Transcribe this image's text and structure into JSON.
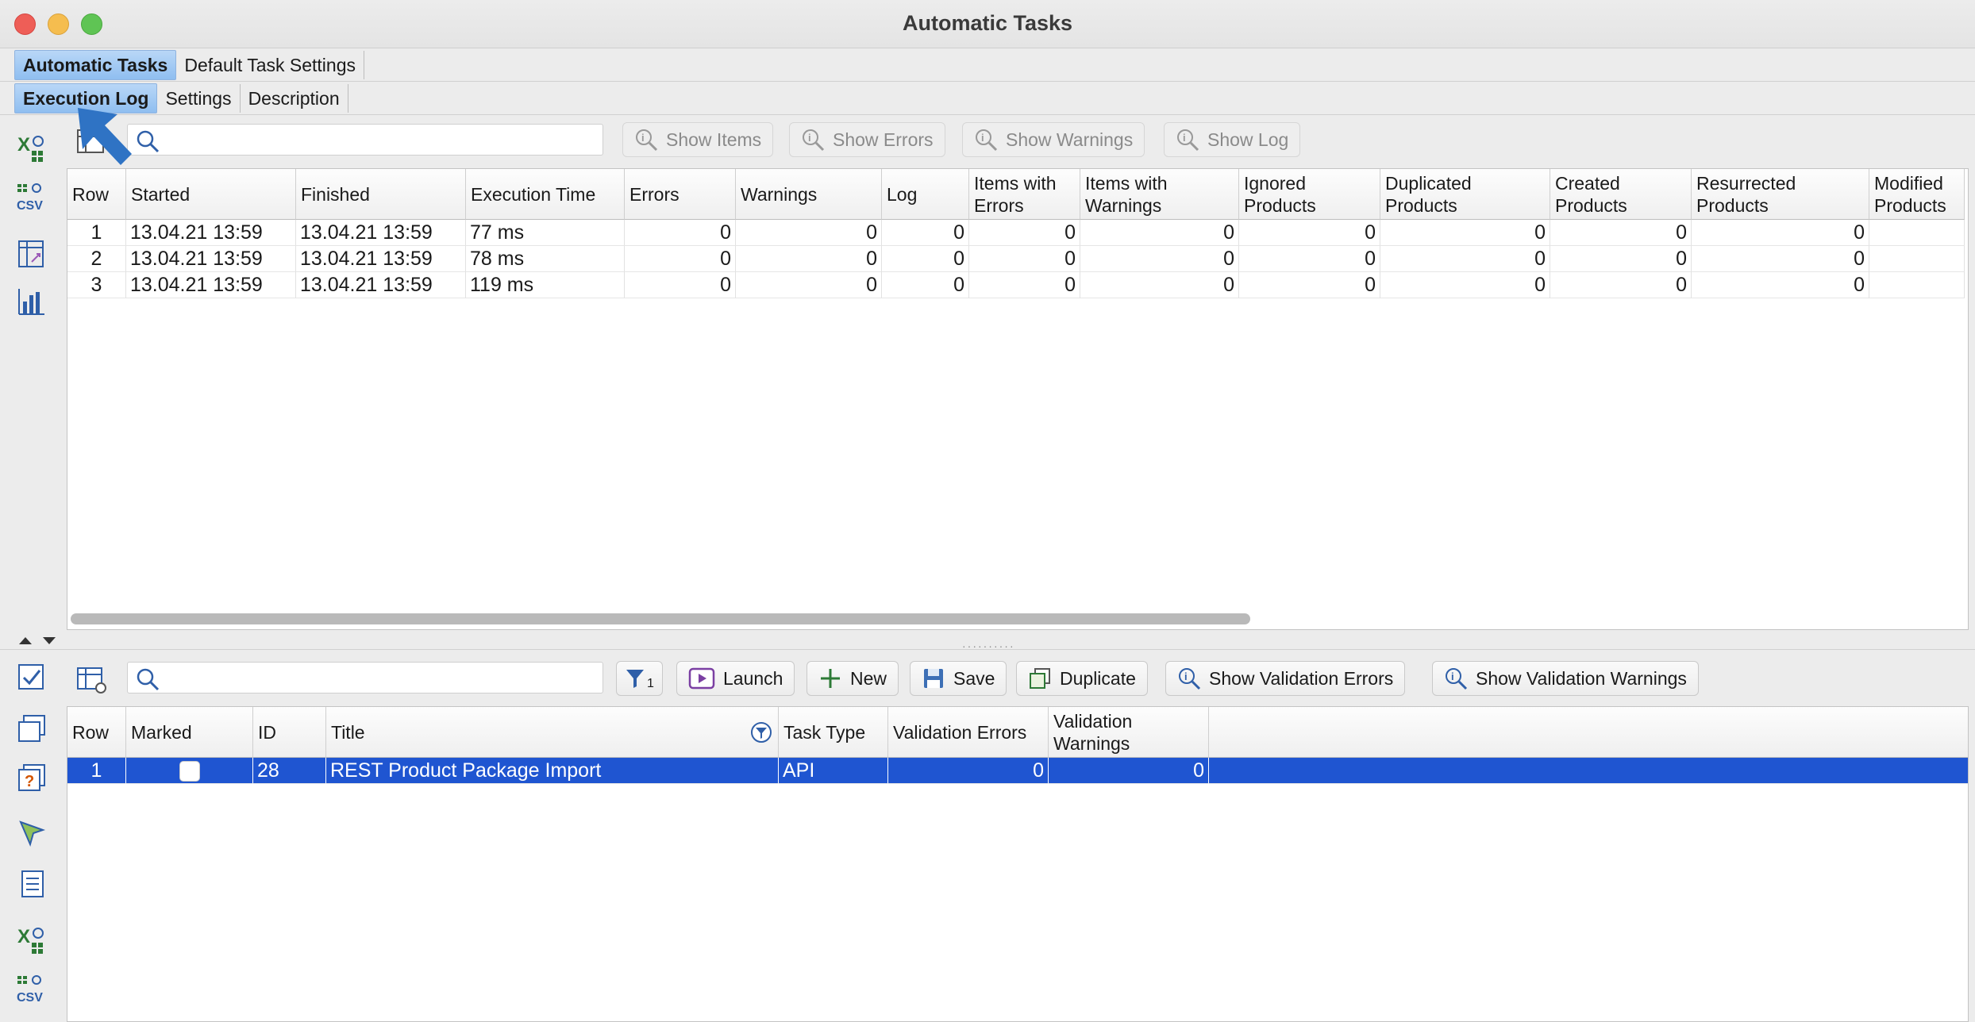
{
  "window": {
    "title": "Automatic Tasks"
  },
  "top_tabs": [
    {
      "label": "Automatic Tasks",
      "active": true
    },
    {
      "label": "Default Task Settings",
      "active": false
    }
  ],
  "sub_tabs": [
    {
      "label": "Execution Log",
      "active": true
    },
    {
      "label": "Settings",
      "active": false
    },
    {
      "label": "Description",
      "active": false
    }
  ],
  "log_toolbar": {
    "search_value": "",
    "buttons": [
      "Show Items",
      "Show Errors",
      "Show Warnings",
      "Show Log"
    ]
  },
  "log_table": {
    "columns": [
      "Row",
      "Started",
      "Finished",
      "Execution Time",
      "Errors",
      "Warnings",
      "Log",
      "Items with\nErrors",
      "Items with\nWarnings",
      "Ignored\nProducts",
      "Duplicated\nProducts",
      "Created\nProducts",
      "Resurrected\nProducts",
      "Modified\nProducts"
    ],
    "rows": [
      [
        "1",
        "13.04.21 13:59",
        "13.04.21 13:59",
        "77 ms",
        "0",
        "0",
        "0",
        "0",
        "0",
        "0",
        "0",
        "0",
        "0",
        ""
      ],
      [
        "2",
        "13.04.21 13:59",
        "13.04.21 13:59",
        "78 ms",
        "0",
        "0",
        "0",
        "0",
        "0",
        "0",
        "0",
        "0",
        "0",
        ""
      ],
      [
        "3",
        "13.04.21 13:59",
        "13.04.21 13:59",
        "119 ms",
        "0",
        "0",
        "0",
        "0",
        "0",
        "0",
        "0",
        "0",
        "0",
        ""
      ]
    ]
  },
  "task_toolbar": {
    "search_value": "",
    "filter_count": "1",
    "buttons": [
      "Launch",
      "New",
      "Save",
      "Duplicate",
      "Show Validation Errors",
      "Show Validation Warnings"
    ]
  },
  "task_table": {
    "columns": [
      "Row",
      "Marked",
      "ID",
      "Title",
      "Task Type",
      "Validation Errors",
      "Validation\nWarnings"
    ],
    "rows": [
      {
        "row": "1",
        "marked": false,
        "id": "28",
        "title": "REST Product Package Import",
        "task_type": "API",
        "validation_errors": "0",
        "validation_warnings": "0",
        "selected": true
      }
    ]
  },
  "colors": {
    "selection": "#1f55d1",
    "tab_active": "#a9cdf4",
    "pointer": "#2f73c4"
  }
}
